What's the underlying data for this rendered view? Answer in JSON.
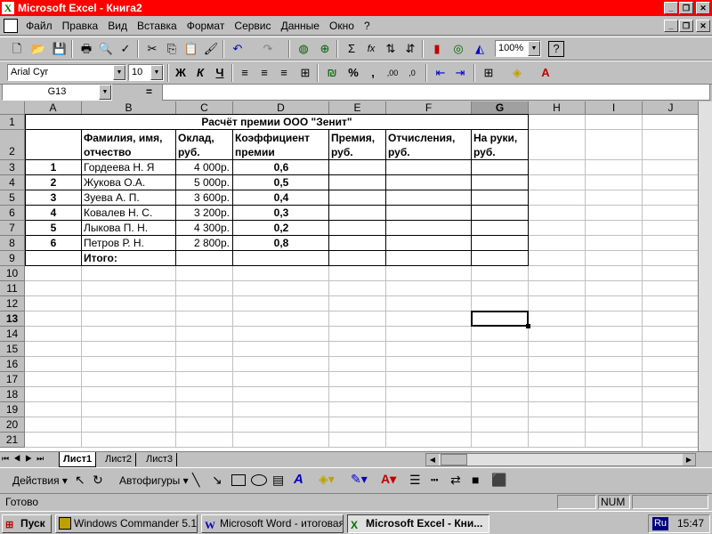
{
  "window": {
    "title": "Microsoft Excel - Книга2"
  },
  "menu": [
    "Файл",
    "Правка",
    "Вид",
    "Вставка",
    "Формат",
    "Сервис",
    "Данные",
    "Окно",
    "?"
  ],
  "toolbar": {
    "zoom": "100%",
    "font": "Arial Cyr",
    "size": "10",
    "bold": "Ж",
    "italic": "К",
    "underline": "Ч",
    "sum": "Σ",
    "fx": "fx",
    "percent": "%",
    "comma": ","
  },
  "formula": {
    "namebox": "G13",
    "eq": "="
  },
  "grid": {
    "columns": [
      "A",
      "B",
      "C",
      "D",
      "E",
      "F",
      "G",
      "H",
      "I",
      "J"
    ],
    "rows": [
      "1",
      "2",
      "3",
      "4",
      "5",
      "6",
      "7",
      "8",
      "9",
      "10",
      "11",
      "12",
      "13",
      "14",
      "15",
      "16",
      "17",
      "18",
      "19",
      "20",
      "21"
    ],
    "title": "Расчёт премии ООО \"Зенит\"",
    "headers": {
      "b1": "Фамилия, имя,",
      "b2": "отчество",
      "c1": "Оклад,",
      "c2": "руб.",
      "d1": "Коэффициент",
      "d2": "премии",
      "e1": "Премия,",
      "e2": "руб.",
      "f1": "Отчисления,",
      "f2": "руб.",
      "g1": "На руки,",
      "g2": "руб."
    },
    "data": [
      {
        "n": "1",
        "name": "Гордеева Н. Я",
        "salary": "4 000р.",
        "coef": "0,6"
      },
      {
        "n": "2",
        "name": "Жукова О.А.",
        "salary": "5 000р.",
        "coef": "0,5"
      },
      {
        "n": "3",
        "name": "Зуева А. П.",
        "salary": "3 600р.",
        "coef": "0,4"
      },
      {
        "n": "4",
        "name": "Ковалев Н. С.",
        "salary": "3 200р.",
        "coef": "0,3"
      },
      {
        "n": "5",
        "name": "Лыкова П. Н.",
        "salary": "4 300р.",
        "coef": "0,2"
      },
      {
        "n": "6",
        "name": "Петров Р. Н.",
        "salary": "2 800р.",
        "coef": "0,8"
      }
    ],
    "total_label": "Итого:"
  },
  "sheets": [
    "Лист1",
    "Лист2",
    "Лист3"
  ],
  "drawing": {
    "actions": "Действия",
    "autoshapes": "Автофигуры"
  },
  "status": {
    "ready": "Готово",
    "num": "NUM"
  },
  "taskbar": {
    "start": "Пуск",
    "items": [
      "Windows Commander 5.11...",
      "Microsoft Word - итоговая...",
      "Microsoft Excel - Кни..."
    ],
    "lang": "Ru",
    "clock": "15:47"
  }
}
